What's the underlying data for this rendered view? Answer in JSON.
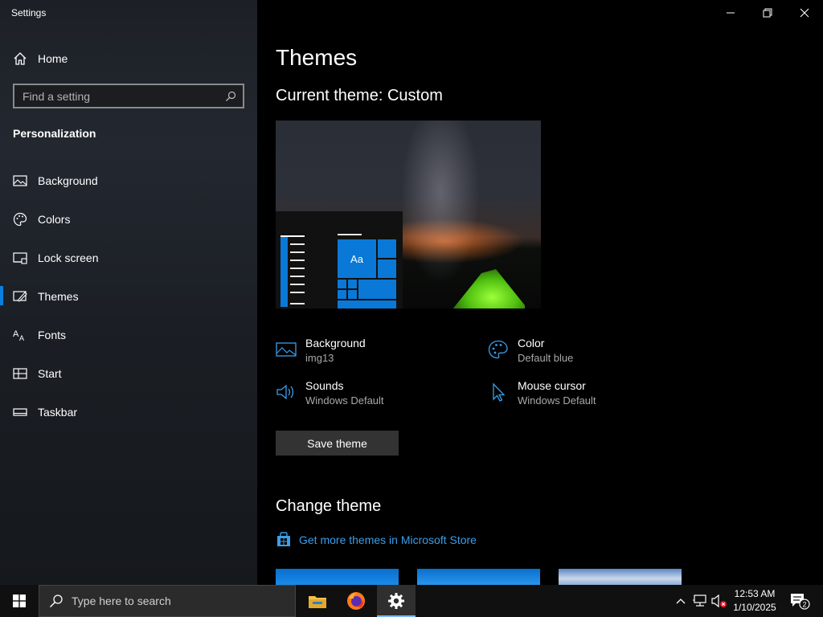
{
  "window": {
    "title": "Settings",
    "controls": [
      "minimize",
      "maximize",
      "close"
    ]
  },
  "sidebar": {
    "home_label": "Home",
    "search_placeholder": "Find a setting",
    "section_title": "Personalization",
    "items": [
      {
        "label": "Background",
        "icon": "picture-icon"
      },
      {
        "label": "Colors",
        "icon": "palette-icon"
      },
      {
        "label": "Lock screen",
        "icon": "lock-screen-icon"
      },
      {
        "label": "Themes",
        "icon": "themes-icon",
        "active": true
      },
      {
        "label": "Fonts",
        "icon": "fonts-icon"
      },
      {
        "label": "Start",
        "icon": "start-icon"
      },
      {
        "label": "Taskbar",
        "icon": "taskbar-icon"
      }
    ]
  },
  "main": {
    "page_title": "Themes",
    "current_theme": "Current theme: Custom",
    "preview": {
      "tile_label": "Aa"
    },
    "properties": [
      {
        "name": "Background",
        "value": "img13",
        "icon": "picture-icon"
      },
      {
        "name": "Color",
        "value": "Default blue",
        "icon": "palette-icon"
      },
      {
        "name": "Sounds",
        "value": "Windows Default",
        "icon": "speaker-icon"
      },
      {
        "name": "Mouse cursor",
        "value": "Windows Default",
        "icon": "cursor-icon"
      }
    ],
    "save_button": "Save theme",
    "change_title": "Change theme",
    "store_link": "Get more themes in Microsoft Store"
  },
  "taskbar": {
    "search_placeholder": "Type here to search",
    "apps": [
      "file-explorer-icon",
      "firefox-icon",
      "settings-gear-icon"
    ],
    "time": "12:53 AM",
    "date": "1/10/2025",
    "notification_count": "2"
  },
  "colors": {
    "accent": "#0078d7",
    "link": "#3a9eea",
    "sidebar_bg": "#1f2329",
    "main_bg": "#000000",
    "taskbar_bg": "#101010"
  }
}
